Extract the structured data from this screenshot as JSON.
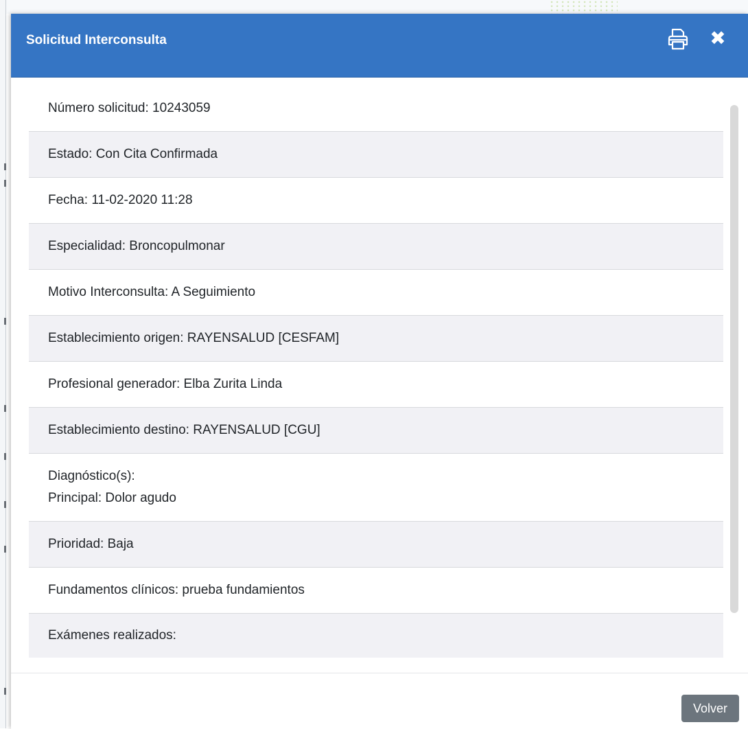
{
  "modal": {
    "title": "Solicitud Interconsulta",
    "print_icon": "printer-icon",
    "close_icon": "close-icon",
    "close_glyph": "✖"
  },
  "details": {
    "numero_solicitud": "Número solicitud: 10243059",
    "estado": "Estado: Con Cita Confirmada",
    "fecha": "Fecha: 11-02-2020 11:28",
    "especialidad": "Especialidad: Broncopulmonar",
    "motivo": "Motivo Interconsulta: A Seguimiento",
    "establecimiento_origen": "Establecimiento origen: RAYENSALUD [CESFAM]",
    "profesional": "Profesional generador: Elba Zurita Linda",
    "establecimiento_destino": "Establecimiento destino: RAYENSALUD [CGU]",
    "diagnostico_label": "Diagnóstico(s):",
    "diagnostico_principal": "Principal: Dolor agudo",
    "prioridad": "Prioridad: Baja",
    "fundamentos": "Fundamentos clínicos: prueba fundamientos",
    "examenes": "Exámenes realizados:"
  },
  "footer": {
    "volver_label": "Volver"
  },
  "colors": {
    "header": "#3575c4",
    "row_alt": "#f1f1f5",
    "button": "#6c757d"
  }
}
